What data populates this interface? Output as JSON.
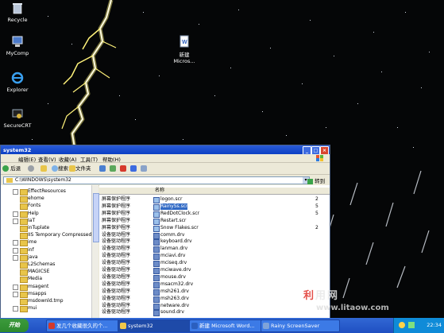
{
  "desktop": {
    "icons": [
      {
        "label": "Recycle",
        "icon": "recycle-bin-icon"
      },
      {
        "label": "MyComp",
        "icon": "my-computer-icon"
      },
      {
        "label": "Explorer",
        "icon": "internet-explorer-icon"
      },
      {
        "label": "SecureCRT",
        "icon": "securecrt-icon"
      },
      {
        "label": "新建",
        "label2": "Micros...",
        "icon": "word-document-icon"
      }
    ]
  },
  "window": {
    "title": "system32",
    "menus": [
      "编辑(E)",
      "查看(V)",
      "收藏(A)",
      "工具(T)",
      "帮助(H)"
    ],
    "toolbar": {
      "back": "后退",
      "search": "搜索",
      "folders": "文件夹"
    },
    "address": "C:\\WINDOWS\\system32",
    "go": "转到",
    "tree_items": [
      {
        "label": "EffectResources",
        "expandable": true
      },
      {
        "label": "ehome",
        "expandable": false
      },
      {
        "label": "Fonts",
        "expandable": false
      },
      {
        "label": "Help",
        "expandable": true
      },
      {
        "label": "IaT",
        "expandable": true
      },
      {
        "label": "inTuplate",
        "expandable": false
      },
      {
        "label": "IIS Temporary Compressed",
        "expandable": false
      },
      {
        "label": "ime",
        "expandable": true
      },
      {
        "label": "inf",
        "expandable": true
      },
      {
        "label": "java",
        "expandable": true
      },
      {
        "label": "L2Schemas",
        "expandable": false
      },
      {
        "label": "MAGICSE",
        "expandable": false
      },
      {
        "label": "Media",
        "expandable": false
      },
      {
        "label": "msagent",
        "expandable": true
      },
      {
        "label": "msapps",
        "expandable": true
      },
      {
        "label": "msdownld.tmp",
        "expandable": false
      },
      {
        "label": "mui",
        "expandable": true
      }
    ],
    "columns": {
      "name": "名称"
    },
    "files": [
      {
        "type": "屏幕保护程序",
        "name": "logon.scr",
        "size": "2"
      },
      {
        "type": "屏幕保护程序",
        "name": "RainySs.scr",
        "size": "5",
        "selected": true
      },
      {
        "type": "屏幕保护程序",
        "name": "RedDotClock.scr",
        "size": "5"
      },
      {
        "type": "屏幕保护程序",
        "name": "Restart.scr",
        "size": ""
      },
      {
        "type": "屏幕保护程序",
        "name": "Snow Flakes.scr",
        "size": "2"
      },
      {
        "type": "设备驱动程序",
        "name": "comm.drv",
        "size": ""
      },
      {
        "type": "设备驱动程序",
        "name": "keyboard.drv",
        "size": ""
      },
      {
        "type": "设备驱动程序",
        "name": "lanman.drv",
        "size": ""
      },
      {
        "type": "设备驱动程序",
        "name": "mciavi.drv",
        "size": ""
      },
      {
        "type": "设备驱动程序",
        "name": "mciseq.drv",
        "size": ""
      },
      {
        "type": "设备驱动程序",
        "name": "mciwave.drv",
        "size": ""
      },
      {
        "type": "设备驱动程序",
        "name": "mouse.drv",
        "size": ""
      },
      {
        "type": "设备驱动程序",
        "name": "msacm32.drv",
        "size": ""
      },
      {
        "type": "设备驱动程序",
        "name": "msh261.drv",
        "size": ""
      },
      {
        "type": "设备驱动程序",
        "name": "msh263.drv",
        "size": ""
      },
      {
        "type": "设备驱动程序",
        "name": "netware.drv",
        "size": ""
      },
      {
        "type": "设备驱动程序",
        "name": "sound.drv",
        "size": ""
      }
    ]
  },
  "taskbar": {
    "start": "开始",
    "tasks": [
      {
        "label": "发几个收藏很久的个...",
        "color": "#d33a2c"
      },
      {
        "label": "system32",
        "color": "#f1c84a",
        "active": true
      },
      {
        "label": "新建 Microsoft Word...",
        "color": "#2b5fbf"
      },
      {
        "label": "Rainy ScreenSaver",
        "color": "#7fa3d8"
      }
    ],
    "clock": "22:34"
  },
  "watermark": {
    "line1_a": "利",
    "line1_b": "用网",
    "line2": "www.litaow.com"
  },
  "colors": {
    "titlebar": "#0b3fc4",
    "taskbar": "#245edb",
    "start": "#3c9a3c",
    "selection": "#316ac5",
    "bolt": "#fff27a"
  }
}
